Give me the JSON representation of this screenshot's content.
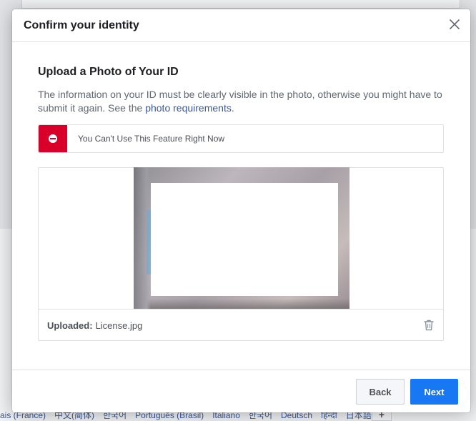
{
  "modal": {
    "title": "Confirm your identity",
    "close_label": "Close"
  },
  "upload": {
    "heading": "Upload a Photo of Your ID",
    "description_prefix": "The information on your ID must be clearly visible in the photo, otherwise you might have to submit it again. See the ",
    "requirements_link": "photo requirements",
    "description_suffix": "."
  },
  "alert": {
    "text": "You Can't Use This Feature Right Now",
    "color": "#d8002b"
  },
  "file": {
    "uploaded_label": "Uploaded:",
    "filename": "License.jpg"
  },
  "footer": {
    "back_label": "Back",
    "next_label": "Next",
    "accent": "#1877f2"
  },
  "background": {
    "languages": [
      "çais (France)",
      "中文(简体)",
      "한국어",
      "Português (Brasil)",
      "Italiano",
      "한국어",
      "Deutsch",
      "हिन्दी",
      "日本語"
    ],
    "more_label": "+"
  }
}
